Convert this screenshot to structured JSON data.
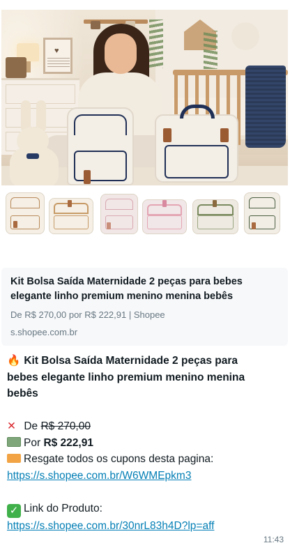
{
  "preview": {
    "title": "Kit Bolsa Saída Maternidade 2 peças para bebes elegante linho premium menino menina bebês",
    "subtitle": "De R$ 270,00 por R$ 222,91 | Shopee",
    "domain": "s.shopee.com.br"
  },
  "message": {
    "icon_headline": "fire-icon",
    "headline": "Kit Bolsa Saída Maternidade 2 peças para bebes elegante linho premium menino menina bebês",
    "headline_lines": [
      "Kit Bolsa Saída Maternidade 2 peças para",
      "bebes elegante linho premium menino menina",
      "bebês"
    ],
    "old_price_label": "De",
    "old_price": "R$ 270,00",
    "new_price_label": "Por",
    "new_price": "R$ 222,91",
    "coupon_text": "Resgate todos os cupons desta pagina:",
    "coupon_link": "https://s.shopee.com.br/W6WMEpkm3",
    "product_label": "Link do Produto:",
    "product_link": "https://s.shopee.com.br/30nrL83h4D?lp=aff",
    "time": "11:43"
  },
  "colors": {
    "link": "#027eb5",
    "meta": "#667781",
    "card_bg": "#f7f8fa",
    "bag_trim": "#1f2f55"
  }
}
